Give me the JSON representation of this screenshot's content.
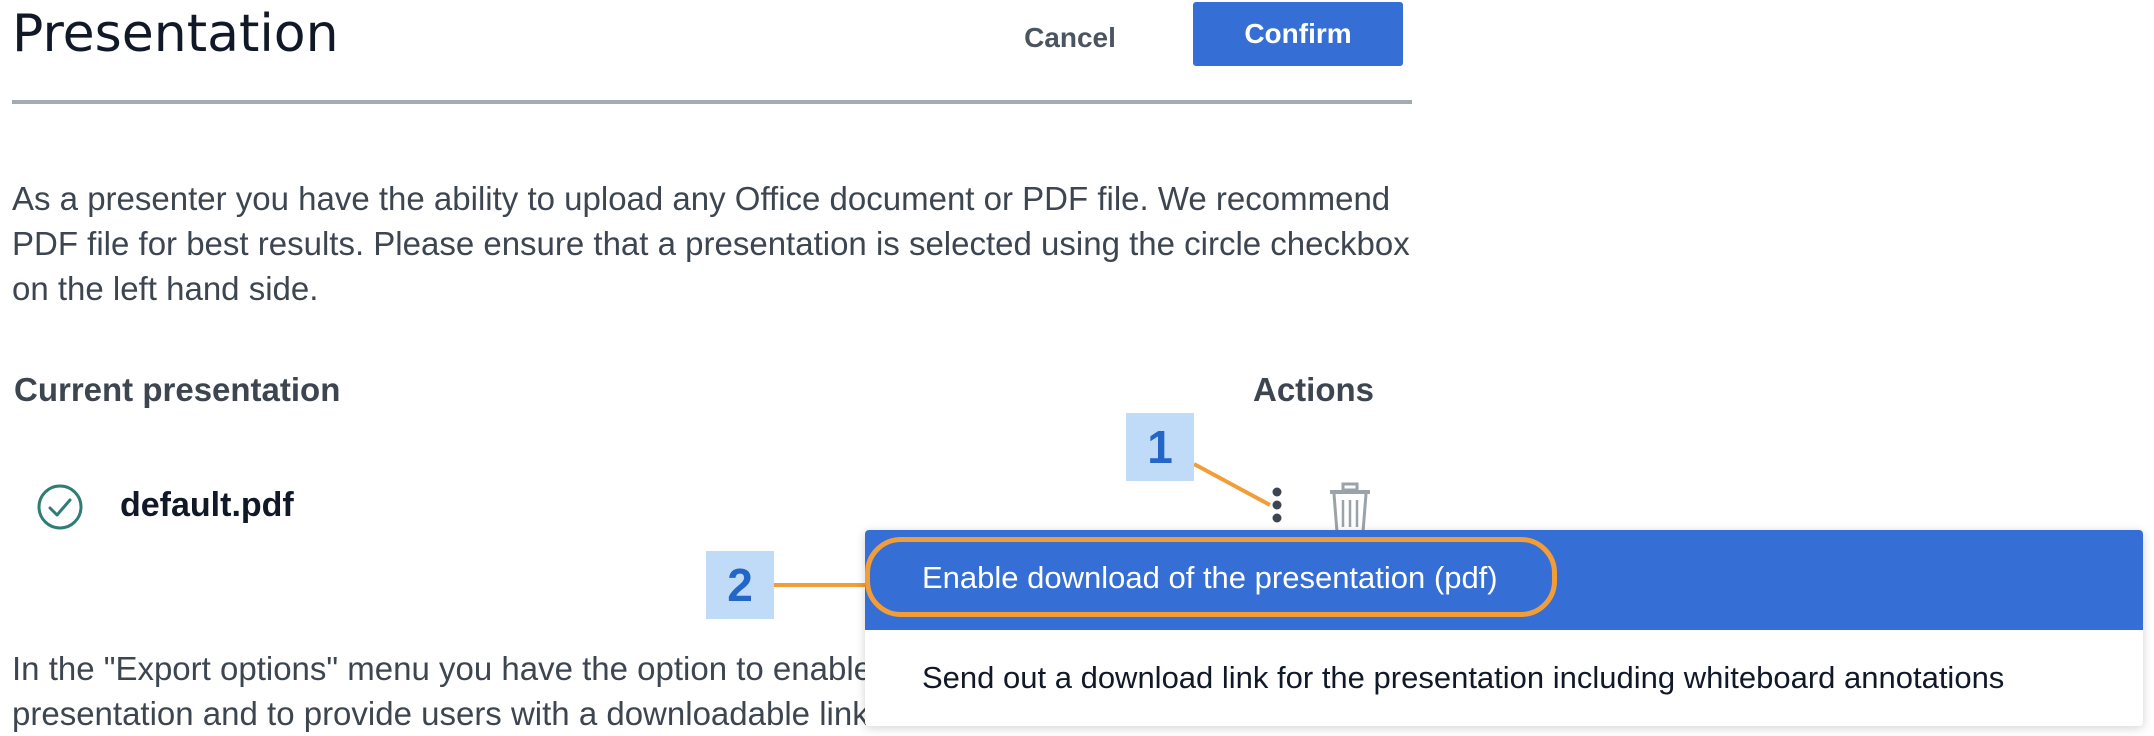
{
  "header": {
    "title": "Presentation",
    "cancel_label": "Cancel",
    "confirm_label": "Confirm"
  },
  "intro": {
    "text": "As a presenter you have the ability to upload any Office document or PDF file. We recommend PDF file for best results. Please ensure that a presentation is selected using the circle checkbox on the left hand side."
  },
  "table": {
    "col_current": "Current presentation",
    "col_actions": "Actions",
    "rows": [
      {
        "file_name": "default.pdf",
        "selected": true
      }
    ]
  },
  "callouts": {
    "one": "1",
    "two": "2"
  },
  "menu": {
    "items": [
      {
        "label": "Enable download of the presentation (pdf)",
        "highlighted": true
      },
      {
        "label": "Send out a download link for the presentation including whiteboard annotations",
        "highlighted": false
      }
    ]
  },
  "export_text": "In the \"Export options\" menu you have the option to enable download of the original presentation and to provide users with a downloadable link",
  "colors": {
    "accent": "#356fd5",
    "callout_bg": "#bfdbf7",
    "callout_text": "#2466c7",
    "highlight_ring": "#f29d38",
    "check_green": "#2f7d75"
  },
  "icons": {
    "check": "check-circle-icon",
    "more": "more-vertical-icon",
    "delete": "trash-icon"
  }
}
